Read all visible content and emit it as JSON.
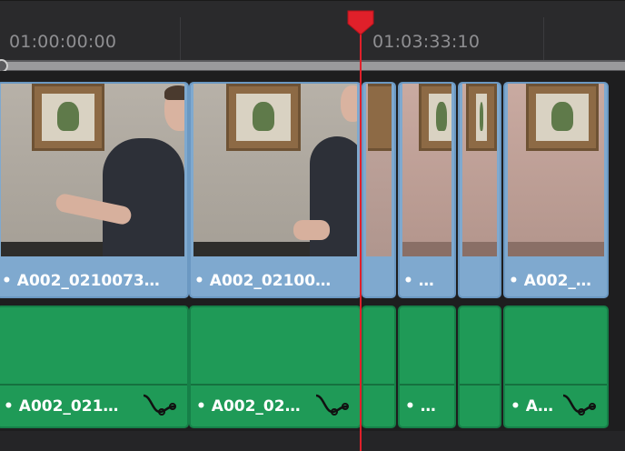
{
  "ruler": {
    "timecode_start": "01:00:00:00",
    "timecode_playhead": "01:03:33:10"
  },
  "video_track": {
    "clips": [
      {
        "name": "• A002_0210073…"
      },
      {
        "name": "• A002_02100…"
      },
      {
        "name": ""
      },
      {
        "name": "• …"
      },
      {
        "name": ""
      },
      {
        "name": "• A002_…"
      }
    ]
  },
  "audio_track": {
    "clips": [
      {
        "name": "• A002_021…",
        "fx": "waveform-curve-icon"
      },
      {
        "name": "• A002_02…",
        "fx": "waveform-curve-icon"
      },
      {
        "name": ""
      },
      {
        "name": "• …"
      },
      {
        "name": ""
      },
      {
        "name": "• A…",
        "fx": "waveform-curve-icon"
      }
    ]
  },
  "colors": {
    "video_clip": "#7fa9cf",
    "audio_clip": "#1f9a57",
    "playhead": "#e0202a"
  }
}
